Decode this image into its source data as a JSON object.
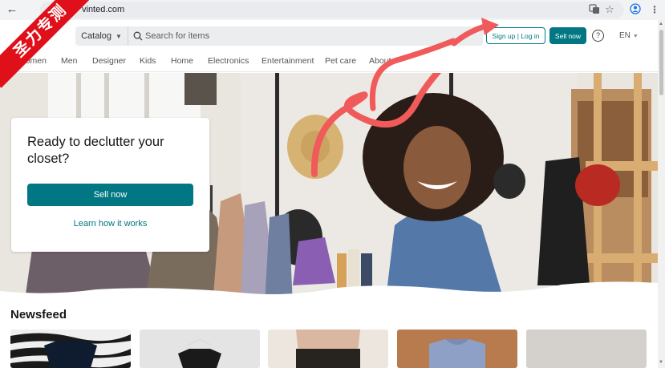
{
  "browser": {
    "url": "vinted.com"
  },
  "header": {
    "catalog_label": "Catalog",
    "search_placeholder": "Search for items",
    "signup_label": "Sign up | Log in",
    "sell_label": "Sell now",
    "lang_label": "EN"
  },
  "categories": [
    "Women",
    "Men",
    "Designer",
    "Kids",
    "Home",
    "Electronics",
    "Entertainment",
    "Pet care",
    "About"
  ],
  "hero": {
    "title": "Ready to declutter your closet?",
    "sell_button": "Sell now",
    "learn_link": "Learn how it works"
  },
  "newsfeed": {
    "title": "Newsfeed"
  },
  "watermark": "圣力专测",
  "colors": {
    "brand": "#007782",
    "arrow": "#f05a5a"
  }
}
